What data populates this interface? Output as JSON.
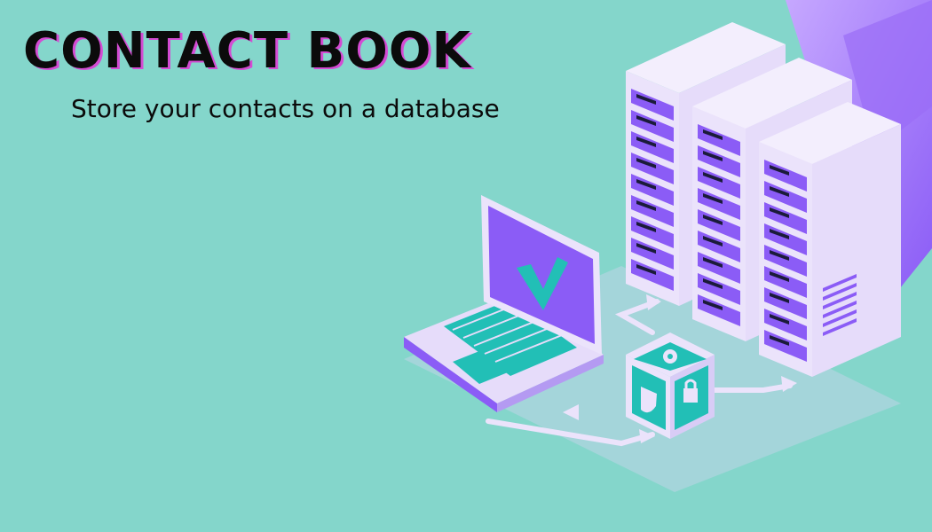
{
  "hero": {
    "title": "CONTACT BOOK",
    "subtitle": "Store your contacts on a database"
  },
  "colors": {
    "background": "#84d6cb",
    "accent_purple": "#8b5cf6",
    "rack_face": "#ebe3fb",
    "teal": "#22bfb6",
    "title_shadow": "#d44bd3"
  },
  "illustration": {
    "icons": [
      "laptop-icon",
      "checkmark-icon",
      "server-rack-icon",
      "security-cube-icon",
      "gear-icon",
      "shield-icon",
      "lock-icon",
      "arrow-icon"
    ]
  }
}
